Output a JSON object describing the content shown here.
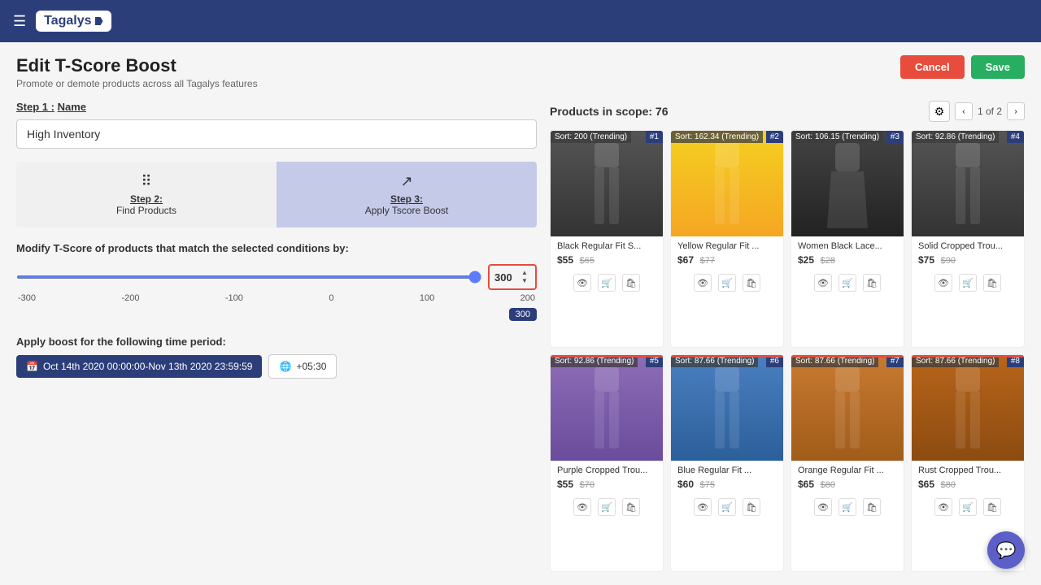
{
  "topnav": {
    "logo_text": "Tagalys"
  },
  "header": {
    "title": "Edit T-Score Boost",
    "subtitle": "Promote or demote products across all Tagalys features",
    "cancel_label": "Cancel",
    "save_label": "Save"
  },
  "step1": {
    "label": "Step 1 :",
    "label_name": "Name",
    "input_value": "High Inventory"
  },
  "step2": {
    "label": "Step 2:",
    "title": "Find Products"
  },
  "step3": {
    "label": "Step 3:",
    "title": "Apply Tscore Boost"
  },
  "modify": {
    "label": "Modify T-Score of products that match the selected conditions by:",
    "slider_min": -300,
    "slider_max": 300,
    "slider_value": 300,
    "ticks": [
      "-300",
      "-200",
      "-100",
      "0",
      "100",
      "200"
    ]
  },
  "time_period": {
    "label": "Apply boost for the following time period:",
    "date_range": "Oct 14th 2020 00:00:00-Nov 13th 2020 23:59:59",
    "timezone": "+05:30"
  },
  "products": {
    "count_label": "Products in scope: 76",
    "pagination": "1 of 2",
    "items": [
      {
        "id": 1,
        "sort_label": "Sort: 200 (Trending)",
        "number": "#1",
        "name": "Black Regular Fit S...",
        "price": "$55",
        "old_price": "$65",
        "img_class": "img-black-pants"
      },
      {
        "id": 2,
        "sort_label": "Sort: 162.34 (Trending)",
        "number": "#2",
        "name": "Yellow Regular Fit ...",
        "price": "$67",
        "old_price": "$77",
        "img_class": "img-yellow-pants"
      },
      {
        "id": 3,
        "sort_label": "Sort: 106.15 (Trending)",
        "number": "#3",
        "name": "Women Black Lace...",
        "price": "$25",
        "old_price": "$28",
        "img_class": "img-black-dress"
      },
      {
        "id": 4,
        "sort_label": "Sort: 92.86 (Trending)",
        "number": "#4",
        "name": "Solid Cropped Trou...",
        "price": "$75",
        "old_price": "$90",
        "img_class": "img-black-crop"
      },
      {
        "id": 5,
        "sort_label": "Sort: 92.86 (Trending)",
        "number": "#5",
        "name": "Purple Cropped Trou...",
        "price": "$55",
        "old_price": "$70",
        "img_class": "img-purple-pants"
      },
      {
        "id": 6,
        "sort_label": "Sort: 87.66 (Trending)",
        "number": "#6",
        "name": "Blue Regular Fit ...",
        "price": "$60",
        "old_price": "$75",
        "img_class": "img-blue-pants"
      },
      {
        "id": 7,
        "sort_label": "Sort: 87.66 (Trending)",
        "number": "#7",
        "name": "Orange Regular Fit ...",
        "price": "$65",
        "old_price": "$80",
        "img_class": "img-orange-pants"
      },
      {
        "id": 8,
        "sort_label": "Sort: 87.66 (Trending)",
        "number": "#8",
        "name": "Rust Cropped Trou...",
        "price": "$65",
        "old_price": "$80",
        "img_class": "img-orange-pants2"
      }
    ]
  },
  "icons": {
    "hamburger": "☰",
    "calendar": "📅",
    "globe": "🌐",
    "eye": "👁",
    "cart": "🛒",
    "bag": "🛍",
    "gear": "⚙",
    "chevron_left": "‹",
    "chevron_right": "›",
    "chevron_up": "▲",
    "chevron_down": "▼",
    "chat": "💬",
    "grid": "⠿",
    "trend": "↗"
  }
}
